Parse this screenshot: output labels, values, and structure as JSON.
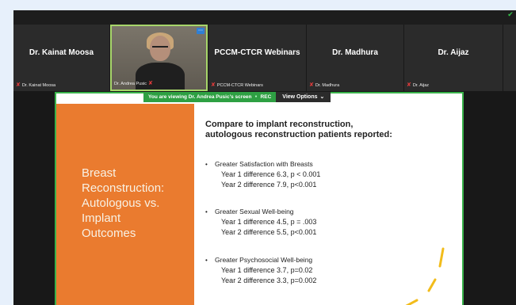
{
  "topbar": {
    "secure_icon": "shield-check-icon",
    "accent": "#35c34b"
  },
  "participants": [
    {
      "name": "Dr. Kainat Moosa",
      "footer": "Dr. Kainat Moosa",
      "muted": true
    },
    {
      "name": "",
      "footer": "Dr. Andrea Pusic",
      "muted": true,
      "video": true
    },
    {
      "name": "PCCM-CTCR Webinars",
      "footer": "PCCM-CTCR Webinars",
      "muted": true
    },
    {
      "name": "Dr. Madhura",
      "footer": "Dr. Madhura",
      "muted": true
    },
    {
      "name": "Dr. Aijaz",
      "footer": "Dr. Aijaz",
      "muted": true
    }
  ],
  "share_banner": {
    "viewing_text": "You are viewing  Dr. Andrea Pusic's screen",
    "rec_label": "REC",
    "view_options": "View Options",
    "color": "#2ea043"
  },
  "slide": {
    "left_title_lines": [
      "Breast",
      "Reconstruction:",
      "Autologous vs.",
      "Implant",
      "Outcomes"
    ],
    "heading_lines": [
      "Compare to implant reconstruction,",
      "autologous reconstruction patients reported:"
    ],
    "bullets": [
      {
        "label": "Greater Satisfaction with Breasts",
        "lines": [
          "Year 1 difference 6.3, p < 0.001",
          "Year 2 difference 7.9, p<0.001"
        ]
      },
      {
        "label": "Greater Sexual Well-being",
        "lines": [
          "Year 1 difference 4.5, p = .003",
          "Year 2 difference 5.5, p<0.001"
        ]
      },
      {
        "label": "Greater Psychosocial Well-being",
        "lines": [
          "Year 1 difference 3.7, p=0.02",
          "Year 2 difference 3.3, p=0.002"
        ]
      }
    ],
    "accent_orange": "#ea7b2f",
    "accent_yellow": "#f2bc1b"
  }
}
